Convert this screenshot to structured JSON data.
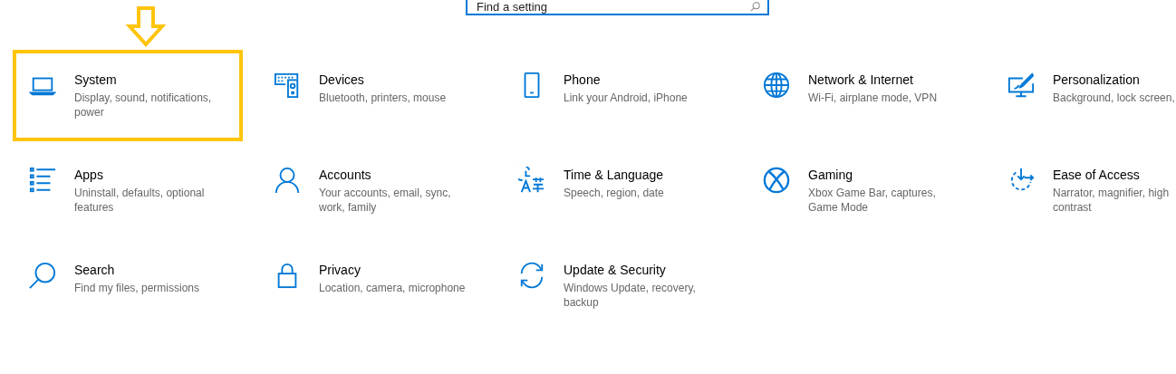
{
  "search": {
    "placeholder": "Find a setting"
  },
  "annotation": {
    "arrow": true
  },
  "categories": [
    {
      "kind": "laptop",
      "title": "System",
      "description": "Display, sound, notifications, power",
      "selected": true
    },
    {
      "kind": "devices",
      "title": "Devices",
      "description": "Bluetooth, printers, mouse",
      "selected": false
    },
    {
      "kind": "phone",
      "title": "Phone",
      "description": "Link your Android, iPhone",
      "selected": false
    },
    {
      "kind": "globe",
      "title": "Network & Internet",
      "description": "Wi-Fi, airplane mode, VPN",
      "selected": false
    },
    {
      "kind": "personalization",
      "title": "Personalization",
      "description": "Background, lock screen,",
      "selected": false
    },
    {
      "kind": "apps",
      "title": "Apps",
      "description": "Uninstall, defaults, optional features",
      "selected": false
    },
    {
      "kind": "person",
      "title": "Accounts",
      "description": "Your accounts, email, sync, work, family",
      "selected": false
    },
    {
      "kind": "time",
      "title": "Time & Language",
      "description": "Speech, region, date",
      "selected": false
    },
    {
      "kind": "gaming",
      "title": "Gaming",
      "description": "Xbox Game Bar, captures, Game Mode",
      "selected": false
    },
    {
      "kind": "ease",
      "title": "Ease of Access",
      "description": "Narrator, magnifier, high contrast",
      "selected": false
    },
    {
      "kind": "search",
      "title": "Search",
      "description": "Find my files, permissions",
      "selected": false
    },
    {
      "kind": "lock",
      "title": "Privacy",
      "description": "Location, camera, microphone",
      "selected": false
    },
    {
      "kind": "update",
      "title": "Update & Security",
      "description": "Windows Update, recovery, backup",
      "selected": false
    }
  ]
}
